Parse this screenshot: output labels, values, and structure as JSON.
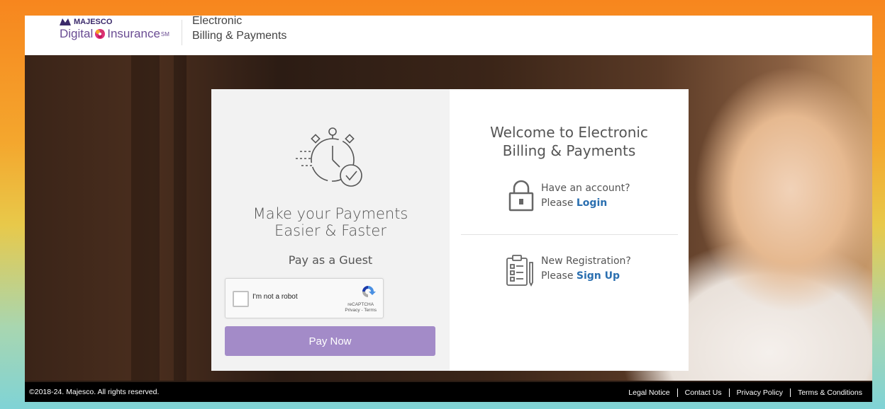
{
  "header": {
    "brand_top": "MAJESCO",
    "brand_left": "Digital",
    "brand_right": "Insurance",
    "brand_tm": "SM",
    "app_title_line1": "Electronic",
    "app_title_line2": "Billing & Payments"
  },
  "guest_panel": {
    "icon": "stopwatch-check-icon",
    "tagline_line1": "Make your Payments",
    "tagline_line2": "Easier & Faster",
    "guest_label": "Pay as a Guest",
    "captcha": {
      "label": "I'm not a robot",
      "brand": "reCAPTCHA",
      "links": "Privacy - Terms"
    },
    "pay_button": "Pay Now"
  },
  "account_panel": {
    "welcome_line1": "Welcome to Electronic",
    "welcome_line2": "Billing & Payments",
    "login": {
      "icon": "lock-icon",
      "question": "Have an account?",
      "prefix": "Please",
      "link": "Login"
    },
    "register": {
      "icon": "clipboard-icon",
      "question": "New Registration?",
      "prefix": "Please",
      "link": "Sign Up"
    }
  },
  "footer": {
    "copyright": "©2018-24. Majesco. All rights reserved.",
    "links": [
      "Legal Notice",
      "Contact Us",
      "Privacy Policy",
      "Terms & Conditions"
    ]
  },
  "colors": {
    "accent_purple": "#a38bc8",
    "link_blue": "#2a6fb0",
    "brand_purple": "#6a4c93"
  }
}
